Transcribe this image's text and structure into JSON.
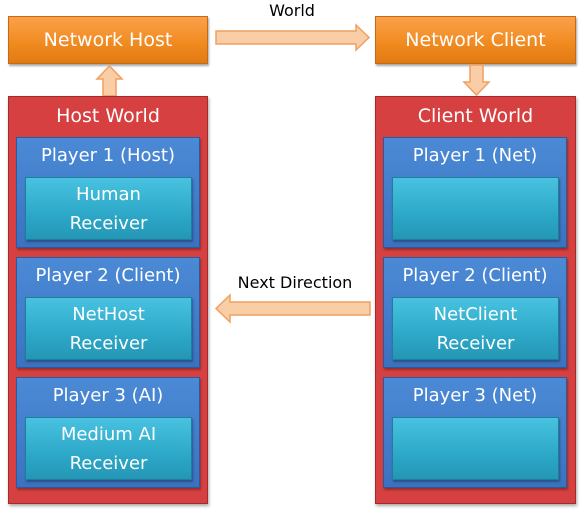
{
  "host": {
    "network_label": "Network Host",
    "world_title": "Host World",
    "players": [
      {
        "title": "Player 1 (Host)",
        "receiver": [
          "Human",
          "Receiver"
        ]
      },
      {
        "title": "Player 2 (Client)",
        "receiver": [
          "NetHost",
          "Receiver"
        ]
      },
      {
        "title": "Player 3 (AI)",
        "receiver": [
          "Medium AI",
          "Receiver"
        ]
      }
    ]
  },
  "client": {
    "network_label": "Network Client",
    "world_title": "Client World",
    "players": [
      {
        "title": "Player 1 (Net)",
        "receiver": [
          "",
          ""
        ]
      },
      {
        "title": "Player 2 (Client)",
        "receiver": [
          "NetClient",
          "Receiver"
        ]
      },
      {
        "title": "Player 3 (Net)",
        "receiver": [
          "",
          ""
        ]
      }
    ]
  },
  "arrows": {
    "world_label": "World",
    "next_direction_label": "Next Direction"
  },
  "colors": {
    "network": "#f08a1f",
    "world": "#d64040",
    "player": "#3b72c0",
    "receiver": "#2da8c8",
    "arrow": "#f9cda6"
  }
}
